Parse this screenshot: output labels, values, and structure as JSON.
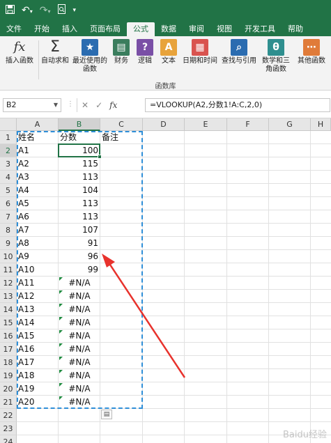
{
  "qat": {
    "save_icon": "save-icon",
    "undo_icon": "undo-icon",
    "redo_icon": "redo-icon",
    "preview_icon": "print-preview-icon"
  },
  "tabs": [
    "文件",
    "开始",
    "插入",
    "页面布局",
    "公式",
    "数据",
    "审阅",
    "视图",
    "开发工具",
    "帮助"
  ],
  "active_tab": "公式",
  "ribbon": {
    "buttons": [
      {
        "label": "插入函数",
        "icon": "fx-icon"
      },
      {
        "label": "自动求和",
        "icon": "sigma-icon",
        "dropdown": true
      },
      {
        "label": "最近使用的函数",
        "icon": "star-book-icon",
        "dropdown": true
      },
      {
        "label": "财务",
        "icon": "finance-book-icon",
        "dropdown": true
      },
      {
        "label": "逻辑",
        "icon": "question-book-icon",
        "dropdown": true
      },
      {
        "label": "文本",
        "icon": "text-book-icon",
        "dropdown": true
      },
      {
        "label": "日期和时间",
        "icon": "calendar-book-icon",
        "dropdown": true
      },
      {
        "label": "查找与引用",
        "icon": "search-book-icon",
        "dropdown": true
      },
      {
        "label": "数学和三角函数",
        "icon": "theta-book-icon",
        "dropdown": true
      },
      {
        "label": "其他函数",
        "icon": "more-book-icon",
        "dropdown": true
      }
    ],
    "group_label": "函数库"
  },
  "formula_bar": {
    "name_box": "B2",
    "cancel": "✕",
    "enter": "✓",
    "fx": "fx",
    "formula": "=VLOOKUP(A2,分数1!A:C,2,0)"
  },
  "columns": [
    "A",
    "B",
    "C",
    "D",
    "E",
    "F",
    "G",
    "H"
  ],
  "rows": [
    1,
    2,
    3,
    4,
    5,
    6,
    7,
    8,
    9,
    10,
    11,
    12,
    13,
    14,
    15,
    16,
    17,
    18,
    19,
    20,
    21,
    22,
    23,
    24
  ],
  "headers": {
    "a": "姓名",
    "b": "分数",
    "c": "备注"
  },
  "data_rows": [
    {
      "name": "A1",
      "score": "100"
    },
    {
      "name": "A2",
      "score": "115"
    },
    {
      "name": "A3",
      "score": "113"
    },
    {
      "name": "A4",
      "score": "104"
    },
    {
      "name": "A5",
      "score": "113"
    },
    {
      "name": "A6",
      "score": "113"
    },
    {
      "name": "A7",
      "score": "107"
    },
    {
      "name": "A8",
      "score": "91"
    },
    {
      "name": "A9",
      "score": "96"
    },
    {
      "name": "A10",
      "score": "99"
    },
    {
      "name": "A11",
      "score": "#N/A"
    },
    {
      "name": "A12",
      "score": "#N/A"
    },
    {
      "name": "A13",
      "score": "#N/A"
    },
    {
      "name": "A14",
      "score": "#N/A"
    },
    {
      "name": "A15",
      "score": "#N/A"
    },
    {
      "name": "A16",
      "score": "#N/A"
    },
    {
      "name": "A17",
      "score": "#N/A"
    },
    {
      "name": "A18",
      "score": "#N/A"
    },
    {
      "name": "A19",
      "score": "#N/A"
    },
    {
      "name": "A20",
      "score": "#N/A"
    }
  ],
  "colors": {
    "brand": "#217346",
    "marquee": "#2f8fd8",
    "arrow": "#e8322c",
    "error_triangle": "#1e8a3e"
  },
  "watermark": "Baidu经验"
}
